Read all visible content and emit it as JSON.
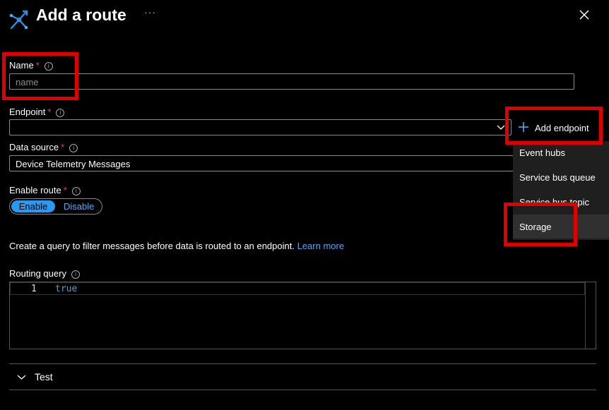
{
  "header": {
    "title": "Add a route",
    "more_label": "···"
  },
  "form": {
    "name": {
      "label": "Name",
      "required": "*",
      "placeholder": "name"
    },
    "endpoint": {
      "label": "Endpoint",
      "required": "*",
      "value": ""
    },
    "add_endpoint": {
      "label": "Add endpoint"
    },
    "data_source": {
      "label": "Data source",
      "required": "*",
      "value": "Device Telemetry Messages"
    },
    "enable_route": {
      "label": "Enable route",
      "required": "*",
      "on_label": "Enable",
      "off_label": "Disable",
      "selected": "Enable"
    },
    "description": {
      "text": "Create a query to filter messages before data is routed to an endpoint.",
      "link": "Learn more"
    },
    "routing_query": {
      "label": "Routing query",
      "line_number": "1",
      "code": "true"
    },
    "test": {
      "label": "Test"
    }
  },
  "endpoint_menu": {
    "items": [
      "Event hubs",
      "Service bus queue",
      "Service bus topic",
      "Storage"
    ],
    "selected": "Storage"
  },
  "colors": {
    "accent": "#2899f5",
    "link": "#4fa9f8",
    "required": "#e3464b",
    "highlight": "#e00000",
    "background": "#000000"
  },
  "icons": {
    "header": "route-icon",
    "close": "close-icon",
    "info": "info-icon",
    "add": "plus-icon",
    "dropdown": "chevron-down-icon",
    "expand": "chevron-down-icon"
  }
}
